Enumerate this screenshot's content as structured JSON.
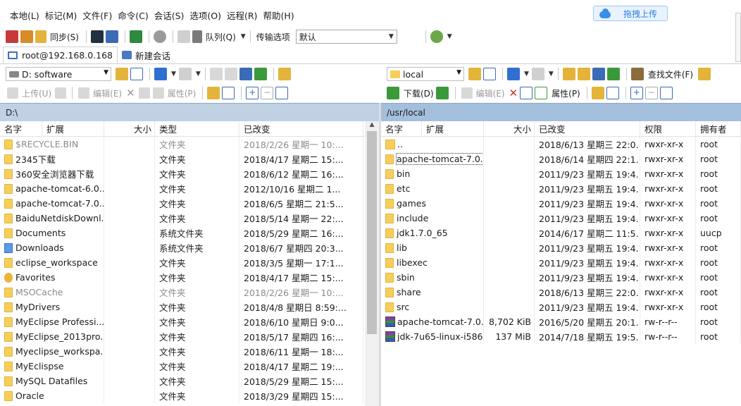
{
  "menu": [
    "本地(L)",
    "标记(M)",
    "文件(F)",
    "命令(C)",
    "会话(S)",
    "选项(O)",
    "远程(R)",
    "帮助(H)"
  ],
  "drag_upload": "拖拽上传",
  "toolbar": {
    "sync": "同步(S)",
    "queue": "队列(Q)",
    "transfer_options_label": "传输选项",
    "transfer_options_value": "默认"
  },
  "tabs": {
    "session": "root@192.168.0.168",
    "new_session": "新建会话"
  },
  "left": {
    "drive": "D: software",
    "upload": "上传(U)",
    "edit": "编辑(E)",
    "properties": "属性(P)",
    "path": "D:\\",
    "columns": [
      "名字",
      "扩展",
      "大小",
      "类型",
      "已改变"
    ],
    "files": [
      {
        "name": "$RECYCLE.BIN",
        "type": "文件夹",
        "changed": "2018/2/26 星期一 10:...",
        "dim": true
      },
      {
        "name": "2345下载",
        "type": "文件夹",
        "changed": "2018/4/17 星期二 15:..."
      },
      {
        "name": "360安全浏览器下载",
        "type": "文件夹",
        "changed": "2018/6/12 星期二 16:..."
      },
      {
        "name": "apache-tomcat-6.0....",
        "type": "文件夹",
        "changed": "2012/10/16 星期二 1..."
      },
      {
        "name": "apache-tomcat-7.0....",
        "type": "文件夹",
        "changed": "2018/6/5 星期二 21:5..."
      },
      {
        "name": "BaiduNetdiskDownl...",
        "type": "文件夹",
        "changed": "2018/5/14 星期一 22:..."
      },
      {
        "name": "Documents",
        "type": "系统文件夹",
        "changed": "2018/5/29 星期二 16:..."
      },
      {
        "name": "Downloads",
        "type": "系统文件夹",
        "changed": "2018/6/7 星期四 20:3..."
      },
      {
        "name": "eclipse_workspace",
        "type": "文件夹",
        "changed": "2018/3/5 星期一 17:1..."
      },
      {
        "name": "Favorites",
        "type": "文件夹",
        "changed": "2018/4/17 星期二 15:..."
      },
      {
        "name": "MSOCache",
        "type": "文件夹",
        "changed": "2018/2/26 星期一 10:...",
        "dim": true
      },
      {
        "name": "MyDrivers",
        "type": "文件夹",
        "changed": "2018/4/8 星期日 8:59:..."
      },
      {
        "name": "MyEclipse Professi...",
        "type": "文件夹",
        "changed": "2018/6/10 星期日 9:0..."
      },
      {
        "name": "MyEclipse_2013pro...",
        "type": "文件夹",
        "changed": "2018/5/17 星期四 16:..."
      },
      {
        "name": "Myeclipse_workspa...",
        "type": "文件夹",
        "changed": "2018/6/11 星期一 18:..."
      },
      {
        "name": "MyEclispse",
        "type": "文件夹",
        "changed": "2018/4/17 星期二 19:..."
      },
      {
        "name": "MySQL Datafiles",
        "type": "文件夹",
        "changed": "2018/5/29 星期二 15:..."
      },
      {
        "name": "Oracle",
        "type": "文件夹",
        "changed": "2018/3/29 星期四 15:..."
      }
    ]
  },
  "right": {
    "dir": "local",
    "find_files": "查找文件(F)",
    "download": "下载(D)",
    "edit": "编辑(E)",
    "properties": "属性(P)",
    "path": "/usr/local",
    "columns": [
      "名字",
      "扩展",
      "大小",
      "已改变",
      "权限",
      "拥有者"
    ],
    "files": [
      {
        "name": "..",
        "size": "",
        "changed": "2018/6/13 星期三 22:0...",
        "perm": "rwxr-xr-x",
        "owner": "root"
      },
      {
        "name": "apache-tomcat-7.0....",
        "size": "",
        "changed": "2018/6/14 星期四 22:1...",
        "perm": "rwxr-xr-x",
        "owner": "root"
      },
      {
        "name": "bin",
        "size": "",
        "changed": "2011/9/23 星期五 19:4...",
        "perm": "rwxr-xr-x",
        "owner": "root"
      },
      {
        "name": "etc",
        "size": "",
        "changed": "2011/9/23 星期五 19:4...",
        "perm": "rwxr-xr-x",
        "owner": "root"
      },
      {
        "name": "games",
        "size": "",
        "changed": "2011/9/23 星期五 19:4...",
        "perm": "rwxr-xr-x",
        "owner": "root"
      },
      {
        "name": "include",
        "size": "",
        "changed": "2011/9/23 星期五 19:4...",
        "perm": "rwxr-xr-x",
        "owner": "root"
      },
      {
        "name": "jdk1.7.0_65",
        "size": "",
        "changed": "2014/6/17 星期二 11:5...",
        "perm": "rwxr-xr-x",
        "owner": "uucp"
      },
      {
        "name": "lib",
        "size": "",
        "changed": "2011/9/23 星期五 19:4...",
        "perm": "rwxr-xr-x",
        "owner": "root"
      },
      {
        "name": "libexec",
        "size": "",
        "changed": "2011/9/23 星期五 19:4...",
        "perm": "rwxr-xr-x",
        "owner": "root"
      },
      {
        "name": "sbin",
        "size": "",
        "changed": "2011/9/23 星期五 19:4...",
        "perm": "rwxr-xr-x",
        "owner": "root"
      },
      {
        "name": "share",
        "size": "",
        "changed": "2018/6/13 星期三 22:0...",
        "perm": "rwxr-xr-x",
        "owner": "root"
      },
      {
        "name": "src",
        "size": "",
        "changed": "2011/9/23 星期五 19:4...",
        "perm": "rwxr-xr-x",
        "owner": "root"
      },
      {
        "name": "apache-tomcat-7.0....",
        "size": "8,702 KiB",
        "changed": "2016/5/20 星期五 20:1...",
        "perm": "rw-r--r--",
        "owner": "root"
      },
      {
        "name": "jdk-7u65-linux-i586....",
        "size": "137 MiB",
        "changed": "2014/7/18 星期五 19:5...",
        "perm": "rw-r--r--",
        "owner": "root"
      }
    ]
  }
}
